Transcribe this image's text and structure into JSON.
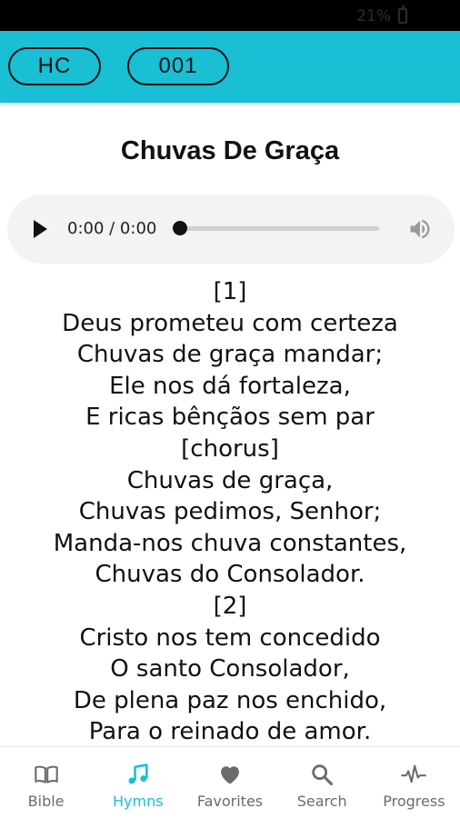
{
  "status_bar": {
    "battery_text": "21%"
  },
  "header": {
    "book_button": "HC",
    "number_button": "001"
  },
  "hymn": {
    "title": "Chuvas De Graça",
    "lyrics": [
      "[1]",
      "Deus prometeu com certeza",
      "Chuvas de graça mandar;",
      "Ele nos dá fortaleza,",
      "E ricas bênçãos sem par",
      "[chorus]",
      "Chuvas de graça,",
      "Chuvas pedimos, Senhor;",
      "Manda-nos chuva constantes,",
      "Chuvas do Consolador.",
      "[2]",
      "Cristo nos tem concedido",
      "O santo Consolador,",
      "De plena paz nos enchido,",
      "Para o reinado de amor."
    ]
  },
  "player": {
    "time": "0:00 / 0:00",
    "progress": 0,
    "icons": {
      "play": "play-icon",
      "volume": "volume-icon"
    }
  },
  "bottom_nav": {
    "items": [
      {
        "label": "Bible",
        "icon": "book-icon",
        "active": false
      },
      {
        "label": "Hymns",
        "icon": "music-note-icon",
        "active": true
      },
      {
        "label": "Favorites",
        "icon": "heart-icon",
        "active": false
      },
      {
        "label": "Search",
        "icon": "search-icon",
        "active": false
      },
      {
        "label": "Progress",
        "icon": "pulse-icon",
        "active": false
      }
    ]
  },
  "colors": {
    "accent": "#19bfd4",
    "nav_inactive": "#6b6b6b",
    "player_bg": "#f1f3f4"
  }
}
